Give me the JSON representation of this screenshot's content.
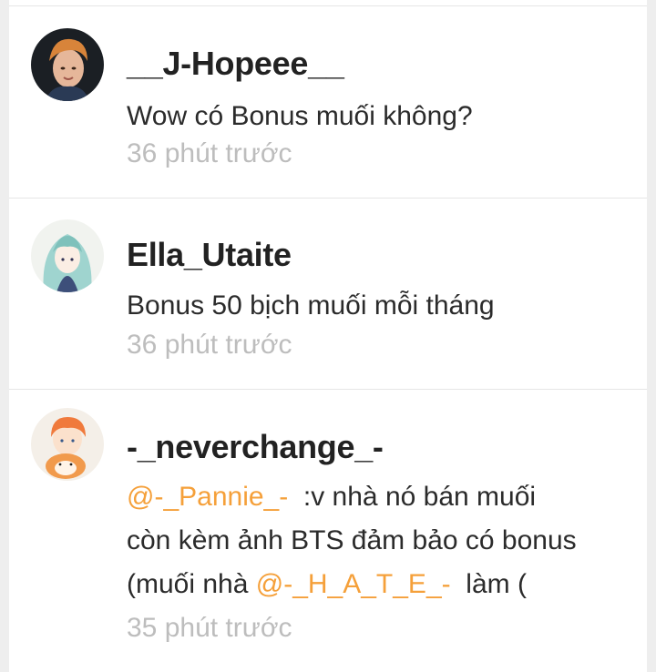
{
  "comments": [
    {
      "username": "__J-Hopeee__",
      "text": "Wow có Bonus muối không?",
      "time": "36 phút trước"
    },
    {
      "username": "Ella_Utaite",
      "text": "Bonus 50 bịch muối mỗi tháng",
      "time": "36 phút trước"
    },
    {
      "username": "-_neverchange_-",
      "line1_mention": "@-_Pannie_-",
      "line1_text": "  :v nhà nó bán muối",
      "line2_text": "còn kèm ảnh BTS đảm bảo có bonus",
      "line3_text": "(muối nhà ",
      "line3_mention": "@-_H_A_T_E_-",
      "line3_tail": "  làm (",
      "time": "35 phút trước"
    }
  ],
  "colors": {
    "mention": "#f5a03a",
    "timestamp": "#bdbdbd",
    "username": "#222222"
  }
}
